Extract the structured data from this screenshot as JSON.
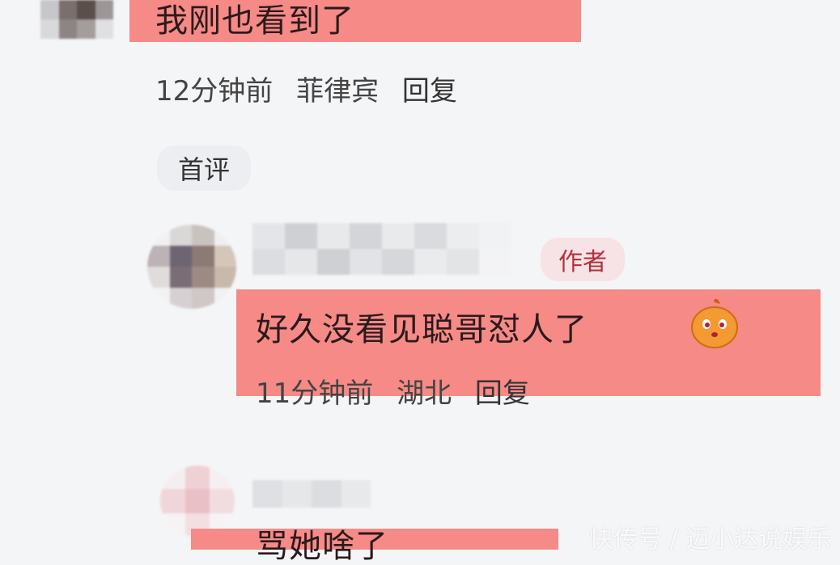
{
  "comments": [
    {
      "text": "我刚也看到了",
      "time": "12分钟前",
      "location": "菲律宾",
      "reply_label": "回复"
    },
    {
      "first_comment_badge": "首评"
    },
    {
      "author_badge": "作者",
      "text": "好久没看见聪哥怼人了",
      "emoji": "orange-face-emoji",
      "time": "11分钟前",
      "location": "湖北",
      "reply_label": "回复"
    },
    {
      "text": "骂她啥了"
    }
  ],
  "watermark": "快传号 / 迈小达说娱乐",
  "colors": {
    "highlight": "#f58a86",
    "background": "#f4f5f7",
    "author_badge_text": "#b3303d"
  }
}
